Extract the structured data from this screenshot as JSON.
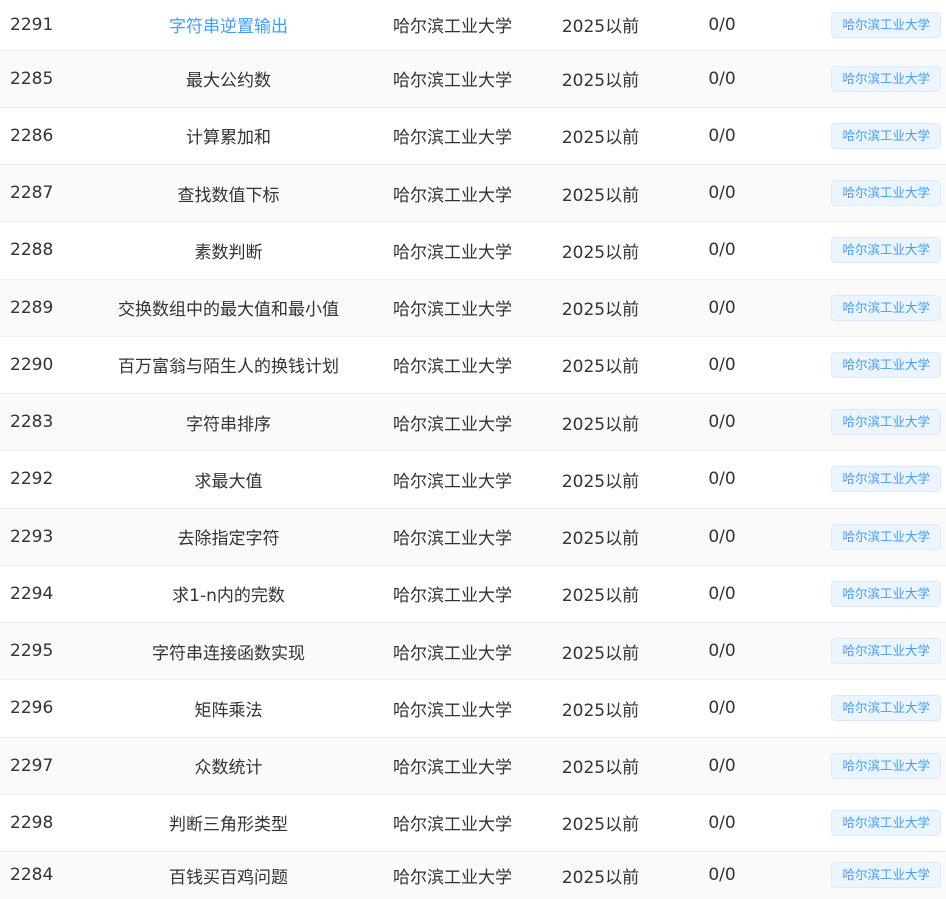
{
  "colors": {
    "link_active": "#409eff",
    "text": "#333333",
    "tag_text": "#409eff",
    "tag_bg": "#ecf5ff",
    "tag_border": "#d9ecff",
    "row_stripe": "#fafafa",
    "row_border": "#ebeef5"
  },
  "rows": [
    {
      "id": "2291",
      "title": "字符串逆置输出",
      "source": "哈尔滨工业大学",
      "year": "2025以前",
      "stat": "0/0",
      "tag": "哈尔滨工业大学",
      "active": true
    },
    {
      "id": "2285",
      "title": "最大公约数",
      "source": "哈尔滨工业大学",
      "year": "2025以前",
      "stat": "0/0",
      "tag": "哈尔滨工业大学"
    },
    {
      "id": "2286",
      "title": "计算累加和",
      "source": "哈尔滨工业大学",
      "year": "2025以前",
      "stat": "0/0",
      "tag": "哈尔滨工业大学"
    },
    {
      "id": "2287",
      "title": "查找数值下标",
      "source": "哈尔滨工业大学",
      "year": "2025以前",
      "stat": "0/0",
      "tag": "哈尔滨工业大学"
    },
    {
      "id": "2288",
      "title": "素数判断",
      "source": "哈尔滨工业大学",
      "year": "2025以前",
      "stat": "0/0",
      "tag": "哈尔滨工业大学"
    },
    {
      "id": "2289",
      "title": "交换数组中的最大值和最小值",
      "source": "哈尔滨工业大学",
      "year": "2025以前",
      "stat": "0/0",
      "tag": "哈尔滨工业大学"
    },
    {
      "id": "2290",
      "title": "百万富翁与陌生人的换钱计划",
      "source": "哈尔滨工业大学",
      "year": "2025以前",
      "stat": "0/0",
      "tag": "哈尔滨工业大学"
    },
    {
      "id": "2283",
      "title": "字符串排序",
      "source": "哈尔滨工业大学",
      "year": "2025以前",
      "stat": "0/0",
      "tag": "哈尔滨工业大学"
    },
    {
      "id": "2292",
      "title": "求最大值",
      "source": "哈尔滨工业大学",
      "year": "2025以前",
      "stat": "0/0",
      "tag": "哈尔滨工业大学"
    },
    {
      "id": "2293",
      "title": "去除指定字符",
      "source": "哈尔滨工业大学",
      "year": "2025以前",
      "stat": "0/0",
      "tag": "哈尔滨工业大学"
    },
    {
      "id": "2294",
      "title": "求1-n内的完数",
      "source": "哈尔滨工业大学",
      "year": "2025以前",
      "stat": "0/0",
      "tag": "哈尔滨工业大学"
    },
    {
      "id": "2295",
      "title": "字符串连接函数实现",
      "source": "哈尔滨工业大学",
      "year": "2025以前",
      "stat": "0/0",
      "tag": "哈尔滨工业大学"
    },
    {
      "id": "2296",
      "title": "矩阵乘法",
      "source": "哈尔滨工业大学",
      "year": "2025以前",
      "stat": "0/0",
      "tag": "哈尔滨工业大学"
    },
    {
      "id": "2297",
      "title": "众数统计",
      "source": "哈尔滨工业大学",
      "year": "2025以前",
      "stat": "0/0",
      "tag": "哈尔滨工业大学"
    },
    {
      "id": "2298",
      "title": "判断三角形类型",
      "source": "哈尔滨工业大学",
      "year": "2025以前",
      "stat": "0/0",
      "tag": "哈尔滨工业大学"
    },
    {
      "id": "2284",
      "title": "百钱买百鸡问题",
      "source": "哈尔滨工业大学",
      "year": "2025以前",
      "stat": "0/0",
      "tag": "哈尔滨工业大学"
    }
  ]
}
